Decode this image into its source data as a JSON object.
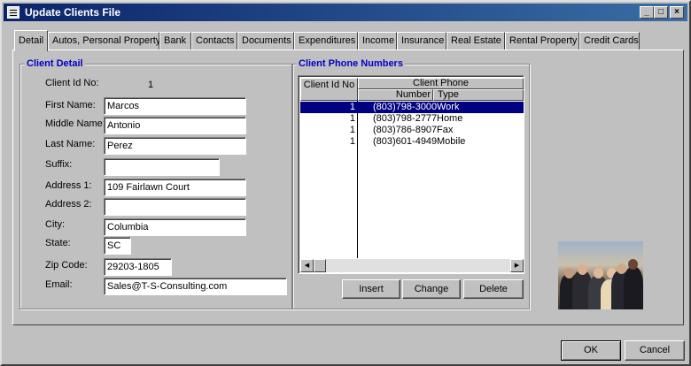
{
  "window": {
    "title": "Update Clients File"
  },
  "tabs": [
    {
      "label": "Detail"
    },
    {
      "label": "Autos, Personal Property"
    },
    {
      "label": "Bank"
    },
    {
      "label": "Contacts"
    },
    {
      "label": "Documents"
    },
    {
      "label": "Expenditures"
    },
    {
      "label": "Income"
    },
    {
      "label": "Insurance"
    },
    {
      "label": "Real Estate"
    },
    {
      "label": "Rental Property"
    },
    {
      "label": "Credit Cards"
    }
  ],
  "detail": {
    "legend": "Client Detail",
    "client_id_label": "Client Id No:",
    "client_id_value": "1",
    "first_name_label": "First Name:",
    "first_name": "Marcos",
    "middle_name_label": "Middle Name:",
    "middle_name": "Antonio",
    "last_name_label": "Last Name:",
    "last_name": "Perez",
    "suffix_label": "Suffix:",
    "suffix": "",
    "address1_label": "Address 1:",
    "address1": "109 Fairlawn Court",
    "address2_label": "Address 2:",
    "address2": "",
    "city_label": "City:",
    "city": "Columbia",
    "state_label": "State:",
    "state": "SC",
    "zip_label": "Zip Code:",
    "zip": "29203-1805",
    "email_label": "Email:",
    "email": "Sales@T-S-Consulting.com"
  },
  "phones": {
    "legend": "Client Phone Numbers",
    "col_id": "Client Id No",
    "col_phone_group": "Client Phone",
    "col_number": "Number",
    "col_type": "Type",
    "rows": [
      {
        "id": "1",
        "number": "(803)798-3000",
        "type": "Work"
      },
      {
        "id": "1",
        "number": "(803)798-2777",
        "type": "Home"
      },
      {
        "id": "1",
        "number": "(803)786-8907",
        "type": "Fax"
      },
      {
        "id": "1",
        "number": "(803)601-4949",
        "type": "Mobile"
      }
    ],
    "insert_label": "Insert",
    "change_label": "Change",
    "delete_label": "Delete"
  },
  "footer": {
    "ok_label": "OK",
    "cancel_label": "Cancel"
  },
  "colors": {
    "title_start": "#0a246a",
    "title_end": "#3a6ea5",
    "legend": "#0000c8",
    "selection": "#000080"
  }
}
